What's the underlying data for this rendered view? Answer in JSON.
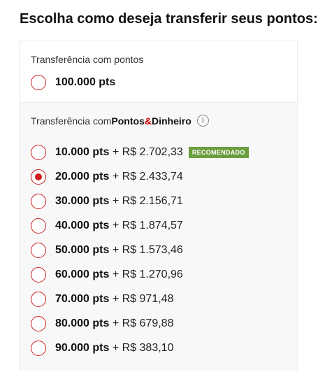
{
  "title": "Escolha como deseja transferir seus pontos:",
  "colors": {
    "accent": "#cc1f1f",
    "badge": "#6b9e3f"
  },
  "points_only": {
    "label": "Transferência com pontos",
    "option": {
      "pts": "100.000 pts",
      "selected": false
    }
  },
  "points_money": {
    "label_prefix": "Transferência com ",
    "label_brand_a": "Pontos",
    "label_brand_amp": "&",
    "label_brand_b": "Dinheiro",
    "info_icon": "i",
    "badge": "RECOMENDADO",
    "options": [
      {
        "pts": "10.000 pts",
        "plus": " + ",
        "money": "R$ 2.702,33",
        "selected": false
      },
      {
        "pts": "20.000 pts",
        "plus": " + ",
        "money": "R$ 2.433,74",
        "selected": true
      },
      {
        "pts": "30.000 pts",
        "plus": " + ",
        "money": "R$ 2.156,71",
        "selected": false
      },
      {
        "pts": "40.000 pts",
        "plus": " + ",
        "money": "R$ 1.874,57",
        "selected": false
      },
      {
        "pts": "50.000 pts",
        "plus": " + ",
        "money": "R$ 1.573,46",
        "selected": false
      },
      {
        "pts": "60.000 pts",
        "plus": " + ",
        "money": "R$ 1.270,96",
        "selected": false
      },
      {
        "pts": "70.000 pts",
        "plus": " + ",
        "money": "R$ 971,48",
        "selected": false
      },
      {
        "pts": "80.000 pts",
        "plus": " + ",
        "money": "R$ 679,88",
        "selected": false
      },
      {
        "pts": "90.000 pts",
        "plus": " + ",
        "money": "R$ 383,10",
        "selected": false
      }
    ]
  }
}
